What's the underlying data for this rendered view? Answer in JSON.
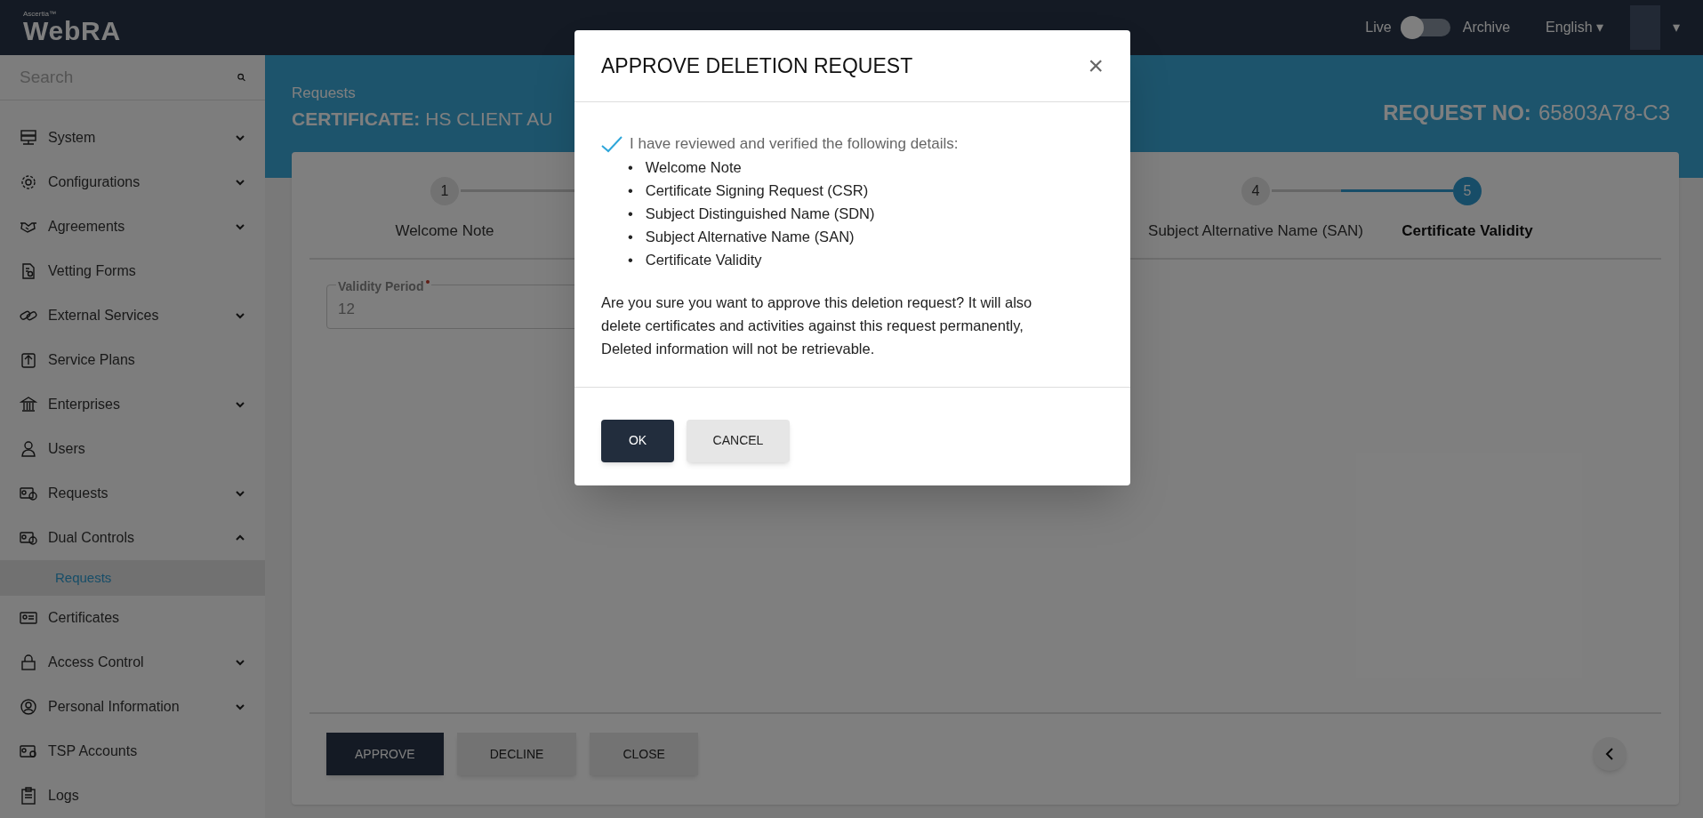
{
  "header": {
    "brand_small": "Ascertia™",
    "brand": "WebRA",
    "live_label": "Live",
    "archive_toggle": {
      "on": false
    },
    "archive_label": "Archive",
    "language": "English ▾",
    "user_menu": "▾"
  },
  "sidebar": {
    "search": {
      "placeholder": "Search"
    },
    "items": [
      {
        "label": "System",
        "kind": "group",
        "expanded": false
      },
      {
        "label": "Configurations",
        "kind": "group",
        "expanded": false
      },
      {
        "label": "Agreements",
        "kind": "group",
        "expanded": false
      },
      {
        "label": "Vetting Forms",
        "kind": "link"
      },
      {
        "label": "External Services",
        "kind": "group",
        "expanded": false
      },
      {
        "label": "Service Plans",
        "kind": "link"
      },
      {
        "label": "Enterprises",
        "kind": "group",
        "expanded": false
      },
      {
        "label": "Users",
        "kind": "link"
      },
      {
        "label": "Requests",
        "kind": "group",
        "expanded": false
      },
      {
        "label": "Dual Controls",
        "kind": "group",
        "expanded": true,
        "children": [
          {
            "label": "Requests",
            "selected": true
          }
        ]
      },
      {
        "label": "Certificates",
        "kind": "link"
      },
      {
        "label": "Access Control",
        "kind": "group",
        "expanded": false
      },
      {
        "label": "Personal Information",
        "kind": "group",
        "expanded": false
      },
      {
        "label": "TSP Accounts",
        "kind": "link"
      },
      {
        "label": "Logs",
        "kind": "link"
      }
    ]
  },
  "page_header": {
    "breadcrumb": "Requests",
    "title_label": "CERTIFICATE:",
    "title_value": "HS CLIENT AU",
    "request_label": "REQUEST NO:",
    "request_value": "65803A78-C3"
  },
  "steps": [
    {
      "number": "1",
      "label": "Welcome Note",
      "selected": false
    },
    {
      "number": "4",
      "label": "Subject Alternative Name (SAN)",
      "selected": false
    },
    {
      "number": "5",
      "label": "Certificate Validity",
      "selected": true
    }
  ],
  "validity_field": {
    "label": "Validity Period",
    "required": true,
    "value": "12"
  },
  "footer_buttons": [
    {
      "label": "APPROVE",
      "kind": "primary"
    },
    {
      "label": "DECLINE",
      "kind": "secondary"
    },
    {
      "label": "CLOSE",
      "kind": "secondary"
    }
  ],
  "dialog": {
    "title": "APPROVE DELETION REQUEST",
    "close": "×",
    "confirm": {
      "checked": true,
      "label": "I have reviewed and verified the following details:"
    },
    "bullet": "•",
    "details": [
      "Welcome Note",
      "Certificate Signing Request (CSR)",
      "Subject Distinguished Name (SDN)",
      "Subject Alternative Name (SAN)",
      "Certificate Validity"
    ],
    "message": "Are you sure you want to approve this deletion request? It will also delete certificates and activities against this request permanently, Deleted information will not be retrievable.",
    "buttons": [
      {
        "label": "OK",
        "kind": "primary"
      },
      {
        "label": "CANCEL",
        "kind": "secondary"
      }
    ]
  }
}
